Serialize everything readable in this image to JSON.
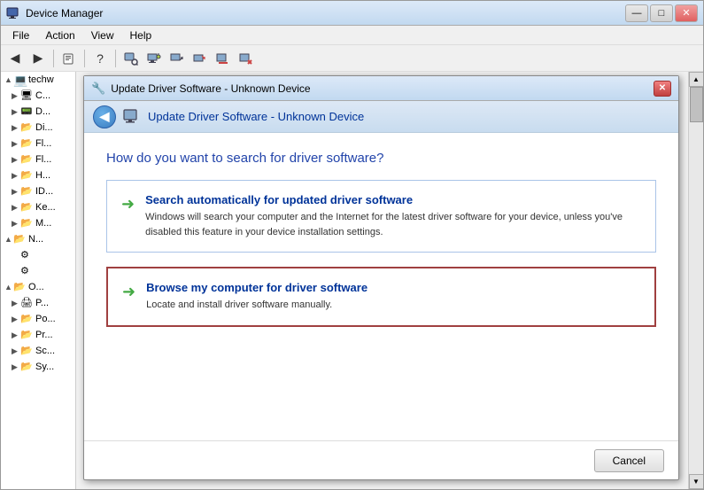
{
  "window": {
    "title": "Device Manager",
    "titlebar_buttons": {
      "minimize": "—",
      "maximize": "□",
      "close": "✕"
    }
  },
  "menubar": {
    "items": [
      {
        "label": "File"
      },
      {
        "label": "Action"
      },
      {
        "label": "View"
      },
      {
        "label": "Help"
      }
    ]
  },
  "dialog": {
    "title": "Update Driver Software - Unknown Device",
    "nav_back": "◀",
    "question": "How do you want to search for driver software?",
    "options": [
      {
        "id": "auto",
        "arrow": "➜",
        "title": "Search automatically for updated driver software",
        "description": "Windows will search your computer and the Internet for the latest driver software for your device, unless you've disabled this feature in your device installation settings."
      },
      {
        "id": "manual",
        "arrow": "➜",
        "title": "Browse my computer for driver software",
        "description": "Locate and install driver software manually."
      }
    ],
    "cancel_button": "Cancel"
  },
  "tree": {
    "items": [
      {
        "indent": 0,
        "expand": "▲",
        "icon": "💻",
        "label": "techw"
      },
      {
        "indent": 1,
        "expand": "▶",
        "icon": "🖥",
        "label": "C..."
      },
      {
        "indent": 1,
        "expand": "▶",
        "icon": "📟",
        "label": "D..."
      },
      {
        "indent": 1,
        "expand": "▶",
        "icon": "📂",
        "label": "Di..."
      },
      {
        "indent": 1,
        "expand": "▶",
        "icon": "📂",
        "label": "Fl..."
      },
      {
        "indent": 1,
        "expand": "▶",
        "icon": "📂",
        "label": "Fl..."
      },
      {
        "indent": 1,
        "expand": "▶",
        "icon": "📂",
        "label": "H..."
      },
      {
        "indent": 1,
        "expand": "▶",
        "icon": "📂",
        "label": "ID..."
      },
      {
        "indent": 1,
        "expand": "▶",
        "icon": "📂",
        "label": "Ke..."
      },
      {
        "indent": 1,
        "expand": "▶",
        "icon": "📂",
        "label": "M..."
      },
      {
        "indent": 0,
        "expand": "▲",
        "icon": "💻",
        "label": "N..."
      },
      {
        "indent": 1,
        "expand": "  ",
        "icon": "⚙",
        "label": ""
      },
      {
        "indent": 1,
        "expand": "  ",
        "icon": "⚙",
        "label": ""
      },
      {
        "indent": 0,
        "expand": "▲",
        "icon": "📂",
        "label": "O..."
      },
      {
        "indent": 1,
        "expand": "▶",
        "icon": "🖨",
        "label": "P..."
      },
      {
        "indent": 1,
        "expand": "▶",
        "icon": "📂",
        "label": "Po..."
      },
      {
        "indent": 1,
        "expand": "▶",
        "icon": "📂",
        "label": "Pr..."
      },
      {
        "indent": 1,
        "expand": "▶",
        "icon": "📂",
        "label": "Sc..."
      },
      {
        "indent": 1,
        "expand": "▶",
        "icon": "📂",
        "label": "Sy..."
      }
    ]
  }
}
